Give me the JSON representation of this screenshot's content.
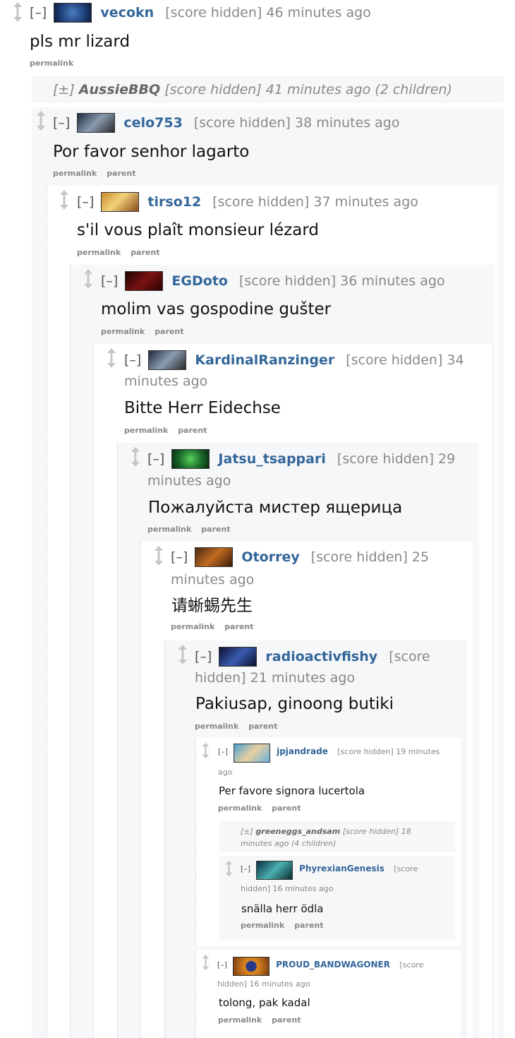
{
  "toggle_minus": "[–]",
  "toggle_plus": "[±]",
  "links": {
    "permalink": "permalink",
    "parent": "parent"
  },
  "colors": {
    "author": "#336699",
    "meta": "#888888",
    "shade": "#f6f7f9"
  },
  "comments": [
    {
      "author": "vecokn",
      "meta": "[score hidden] 46 minutes ago",
      "body": "pls mr lizard",
      "avatar": "dota-logo-avatar"
    },
    {
      "collapsed": true,
      "author": "AussieBBQ",
      "meta": "[score hidden] 41 minutes ago (2 children)"
    },
    {
      "author": "celo753",
      "meta": "[score hidden] 38 minutes ago",
      "body": "Por favor senhor lagarto",
      "avatar": "hero-avatar"
    },
    {
      "author": "tirso12",
      "meta": "[score hidden] 37 minutes ago",
      "body": "s'il vous plaît monsieur lézard",
      "avatar": "hero-avatar"
    },
    {
      "author": "EGDoto",
      "meta": "[score hidden] 36 minutes ago",
      "body": "molim vas gospodine gušter",
      "avatar": "hero-avatar"
    },
    {
      "author": "KardinalRanzinger",
      "meta": "[score hidden] 34",
      "meta2": "minutes ago",
      "body": "Bitte Herr Eidechse",
      "avatar": "hero-avatar"
    },
    {
      "author": "Jatsu_tsappari",
      "meta": "[score hidden] 29",
      "meta2": "minutes ago",
      "body": "Пожалуйста мистер ящерица",
      "avatar": "og-logo-avatar"
    },
    {
      "author": "Otorrey",
      "meta": "[score hidden] 25",
      "meta2": "minutes ago",
      "body": "请蜥蜴先生",
      "avatar": "hero-avatar"
    },
    {
      "author": "radioactivfishy",
      "meta": "[score",
      "meta2": "hidden] 21 minutes ago",
      "body": "Pakiusap, ginoong butiki",
      "avatar": "vici-logo-avatar"
    },
    {
      "author": "jpjandrade",
      "meta": "[score hidden] 19 minutes",
      "meta2": "ago",
      "body": "Per favore signora lucertola",
      "avatar": "hero-avatar"
    },
    {
      "collapsed": true,
      "author": "greeneggs_andsam",
      "meta": "[score hidden] 18",
      "meta2": "minutes ago (4 children)"
    },
    {
      "author": "PhyrexianGenesis",
      "meta": "[score",
      "meta2": "hidden] 16 minutes ago",
      "body": "snälla herr ödla",
      "avatar": "hero-avatar"
    },
    {
      "author": "PROUD_BANDWAGONER",
      "meta": "[score",
      "meta2": "hidden] 16 minutes ago",
      "body": "tolong, pak kadal",
      "avatar": "team-logo-avatar"
    }
  ]
}
